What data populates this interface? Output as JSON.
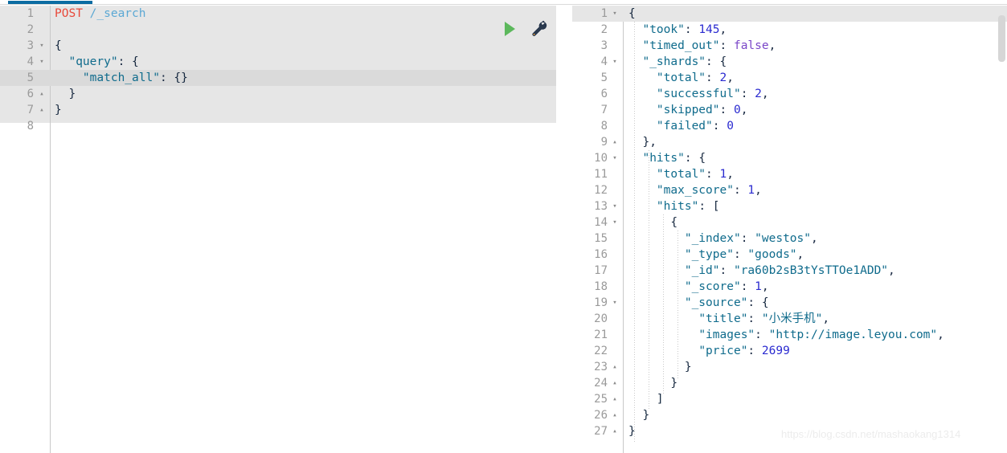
{
  "window": {
    "accent_color": "#0c6ca2",
    "editor_bg": "#e6e6e6",
    "highlight_bg": "#dadada"
  },
  "request_editor": {
    "name": "request-editor",
    "active_line": 5,
    "actions": {
      "run_label": "run-request",
      "tool_label": "settings-wrench"
    },
    "lines": [
      {
        "num": "1",
        "fold": "",
        "highlight": false,
        "tokens": [
          {
            "t": "POST",
            "c": "t-verb"
          },
          {
            "t": " ",
            "c": "t-punc"
          },
          {
            "t": "/_search",
            "c": "t-path"
          }
        ]
      },
      {
        "num": "2",
        "fold": "",
        "highlight": false,
        "tokens": []
      },
      {
        "num": "3",
        "fold": "▾",
        "highlight": false,
        "tokens": [
          {
            "t": "{",
            "c": "t-brace"
          }
        ]
      },
      {
        "num": "4",
        "fold": "▾",
        "highlight": false,
        "tokens": [
          {
            "t": "  ",
            "c": "t-punc"
          },
          {
            "t": "\"query\"",
            "c": "t-key"
          },
          {
            "t": ": ",
            "c": "t-punc"
          },
          {
            "t": "{",
            "c": "t-brace"
          }
        ]
      },
      {
        "num": "5",
        "fold": "",
        "highlight": true,
        "tokens": [
          {
            "t": "    ",
            "c": "t-punc"
          },
          {
            "t": "\"match_all\"",
            "c": "t-key"
          },
          {
            "t": ": ",
            "c": "t-punc"
          },
          {
            "t": "{}",
            "c": "t-brace"
          }
        ]
      },
      {
        "num": "6",
        "fold": "▴",
        "highlight": false,
        "tokens": [
          {
            "t": "  ",
            "c": "t-punc"
          },
          {
            "t": "}",
            "c": "t-brace"
          }
        ]
      },
      {
        "num": "7",
        "fold": "▴",
        "highlight": false,
        "tokens": [
          {
            "t": "}",
            "c": "t-brace"
          }
        ]
      },
      {
        "num": "8",
        "fold": "",
        "highlight": false,
        "tokens": []
      }
    ]
  },
  "response_viewer": {
    "name": "response-viewer",
    "active_line": 1,
    "lines": [
      {
        "num": "1",
        "fold": "▾",
        "highlight": true,
        "tokens": [
          {
            "t": "{",
            "c": "t-brace"
          }
        ]
      },
      {
        "num": "2",
        "fold": "",
        "highlight": false,
        "tokens": [
          {
            "t": "  ",
            "c": "t-punc"
          },
          {
            "t": "\"took\"",
            "c": "t-key"
          },
          {
            "t": ": ",
            "c": "t-punc"
          },
          {
            "t": "145",
            "c": "t-num"
          },
          {
            "t": ",",
            "c": "t-punc"
          }
        ]
      },
      {
        "num": "3",
        "fold": "",
        "highlight": false,
        "tokens": [
          {
            "t": "  ",
            "c": "t-punc"
          },
          {
            "t": "\"timed_out\"",
            "c": "t-key"
          },
          {
            "t": ": ",
            "c": "t-punc"
          },
          {
            "t": "false",
            "c": "t-bool"
          },
          {
            "t": ",",
            "c": "t-punc"
          }
        ]
      },
      {
        "num": "4",
        "fold": "▾",
        "highlight": false,
        "tokens": [
          {
            "t": "  ",
            "c": "t-punc"
          },
          {
            "t": "\"_shards\"",
            "c": "t-key"
          },
          {
            "t": ": ",
            "c": "t-punc"
          },
          {
            "t": "{",
            "c": "t-brace"
          }
        ]
      },
      {
        "num": "5",
        "fold": "",
        "highlight": false,
        "tokens": [
          {
            "t": "    ",
            "c": "t-punc"
          },
          {
            "t": "\"total\"",
            "c": "t-key"
          },
          {
            "t": ": ",
            "c": "t-punc"
          },
          {
            "t": "2",
            "c": "t-num"
          },
          {
            "t": ",",
            "c": "t-punc"
          }
        ]
      },
      {
        "num": "6",
        "fold": "",
        "highlight": false,
        "tokens": [
          {
            "t": "    ",
            "c": "t-punc"
          },
          {
            "t": "\"successful\"",
            "c": "t-key"
          },
          {
            "t": ": ",
            "c": "t-punc"
          },
          {
            "t": "2",
            "c": "t-num"
          },
          {
            "t": ",",
            "c": "t-punc"
          }
        ]
      },
      {
        "num": "7",
        "fold": "",
        "highlight": false,
        "tokens": [
          {
            "t": "    ",
            "c": "t-punc"
          },
          {
            "t": "\"skipped\"",
            "c": "t-key"
          },
          {
            "t": ": ",
            "c": "t-punc"
          },
          {
            "t": "0",
            "c": "t-num"
          },
          {
            "t": ",",
            "c": "t-punc"
          }
        ]
      },
      {
        "num": "8",
        "fold": "",
        "highlight": false,
        "tokens": [
          {
            "t": "    ",
            "c": "t-punc"
          },
          {
            "t": "\"failed\"",
            "c": "t-key"
          },
          {
            "t": ": ",
            "c": "t-punc"
          },
          {
            "t": "0",
            "c": "t-num"
          }
        ]
      },
      {
        "num": "9",
        "fold": "▴",
        "highlight": false,
        "tokens": [
          {
            "t": "  ",
            "c": "t-punc"
          },
          {
            "t": "}",
            "c": "t-brace"
          },
          {
            "t": ",",
            "c": "t-punc"
          }
        ]
      },
      {
        "num": "10",
        "fold": "▾",
        "highlight": false,
        "tokens": [
          {
            "t": "  ",
            "c": "t-punc"
          },
          {
            "t": "\"hits\"",
            "c": "t-key"
          },
          {
            "t": ": ",
            "c": "t-punc"
          },
          {
            "t": "{",
            "c": "t-brace"
          }
        ]
      },
      {
        "num": "11",
        "fold": "",
        "highlight": false,
        "tokens": [
          {
            "t": "    ",
            "c": "t-punc"
          },
          {
            "t": "\"total\"",
            "c": "t-key"
          },
          {
            "t": ": ",
            "c": "t-punc"
          },
          {
            "t": "1",
            "c": "t-num"
          },
          {
            "t": ",",
            "c": "t-punc"
          }
        ]
      },
      {
        "num": "12",
        "fold": "",
        "highlight": false,
        "tokens": [
          {
            "t": "    ",
            "c": "t-punc"
          },
          {
            "t": "\"max_score\"",
            "c": "t-key"
          },
          {
            "t": ": ",
            "c": "t-punc"
          },
          {
            "t": "1",
            "c": "t-num"
          },
          {
            "t": ",",
            "c": "t-punc"
          }
        ]
      },
      {
        "num": "13",
        "fold": "▾",
        "highlight": false,
        "tokens": [
          {
            "t": "    ",
            "c": "t-punc"
          },
          {
            "t": "\"hits\"",
            "c": "t-key"
          },
          {
            "t": ": ",
            "c": "t-punc"
          },
          {
            "t": "[",
            "c": "t-brace"
          }
        ]
      },
      {
        "num": "14",
        "fold": "▾",
        "highlight": false,
        "tokens": [
          {
            "t": "      ",
            "c": "t-punc"
          },
          {
            "t": "{",
            "c": "t-brace"
          }
        ]
      },
      {
        "num": "15",
        "fold": "",
        "highlight": false,
        "tokens": [
          {
            "t": "        ",
            "c": "t-punc"
          },
          {
            "t": "\"_index\"",
            "c": "t-key"
          },
          {
            "t": ": ",
            "c": "t-punc"
          },
          {
            "t": "\"westos\"",
            "c": "t-str"
          },
          {
            "t": ",",
            "c": "t-punc"
          }
        ]
      },
      {
        "num": "16",
        "fold": "",
        "highlight": false,
        "tokens": [
          {
            "t": "        ",
            "c": "t-punc"
          },
          {
            "t": "\"_type\"",
            "c": "t-key"
          },
          {
            "t": ": ",
            "c": "t-punc"
          },
          {
            "t": "\"goods\"",
            "c": "t-str"
          },
          {
            "t": ",",
            "c": "t-punc"
          }
        ]
      },
      {
        "num": "17",
        "fold": "",
        "highlight": false,
        "tokens": [
          {
            "t": "        ",
            "c": "t-punc"
          },
          {
            "t": "\"_id\"",
            "c": "t-key"
          },
          {
            "t": ": ",
            "c": "t-punc"
          },
          {
            "t": "\"ra60b2sB3tYsTTOe1ADD\"",
            "c": "t-str"
          },
          {
            "t": ",",
            "c": "t-punc"
          }
        ]
      },
      {
        "num": "18",
        "fold": "",
        "highlight": false,
        "tokens": [
          {
            "t": "        ",
            "c": "t-punc"
          },
          {
            "t": "\"_score\"",
            "c": "t-key"
          },
          {
            "t": ": ",
            "c": "t-punc"
          },
          {
            "t": "1",
            "c": "t-num"
          },
          {
            "t": ",",
            "c": "t-punc"
          }
        ]
      },
      {
        "num": "19",
        "fold": "▾",
        "highlight": false,
        "tokens": [
          {
            "t": "        ",
            "c": "t-punc"
          },
          {
            "t": "\"_source\"",
            "c": "t-key"
          },
          {
            "t": ": ",
            "c": "t-punc"
          },
          {
            "t": "{",
            "c": "t-brace"
          }
        ]
      },
      {
        "num": "20",
        "fold": "",
        "highlight": false,
        "tokens": [
          {
            "t": "          ",
            "c": "t-punc"
          },
          {
            "t": "\"title\"",
            "c": "t-key"
          },
          {
            "t": ": ",
            "c": "t-punc"
          },
          {
            "t": "\"小米手机\"",
            "c": "t-str"
          },
          {
            "t": ",",
            "c": "t-punc"
          }
        ]
      },
      {
        "num": "21",
        "fold": "",
        "highlight": false,
        "tokens": [
          {
            "t": "          ",
            "c": "t-punc"
          },
          {
            "t": "\"images\"",
            "c": "t-key"
          },
          {
            "t": ": ",
            "c": "t-punc"
          },
          {
            "t": "\"http://image.leyou.com\"",
            "c": "t-str"
          },
          {
            "t": ",",
            "c": "t-punc"
          }
        ]
      },
      {
        "num": "22",
        "fold": "",
        "highlight": false,
        "tokens": [
          {
            "t": "          ",
            "c": "t-punc"
          },
          {
            "t": "\"price\"",
            "c": "t-key"
          },
          {
            "t": ": ",
            "c": "t-punc"
          },
          {
            "t": "2699",
            "c": "t-num"
          }
        ]
      },
      {
        "num": "23",
        "fold": "▴",
        "highlight": false,
        "tokens": [
          {
            "t": "        ",
            "c": "t-punc"
          },
          {
            "t": "}",
            "c": "t-brace"
          }
        ]
      },
      {
        "num": "24",
        "fold": "▴",
        "highlight": false,
        "tokens": [
          {
            "t": "      ",
            "c": "t-punc"
          },
          {
            "t": "}",
            "c": "t-brace"
          }
        ]
      },
      {
        "num": "25",
        "fold": "▴",
        "highlight": false,
        "tokens": [
          {
            "t": "    ",
            "c": "t-punc"
          },
          {
            "t": "]",
            "c": "t-brace"
          }
        ]
      },
      {
        "num": "26",
        "fold": "▴",
        "highlight": false,
        "tokens": [
          {
            "t": "  ",
            "c": "t-punc"
          },
          {
            "t": "}",
            "c": "t-brace"
          }
        ]
      },
      {
        "num": "27",
        "fold": "▴",
        "highlight": false,
        "tokens": [
          {
            "t": "}",
            "c": "t-brace"
          }
        ]
      }
    ]
  },
  "watermark": {
    "text": "https://blog.csdn.net/mashaokang1314"
  }
}
